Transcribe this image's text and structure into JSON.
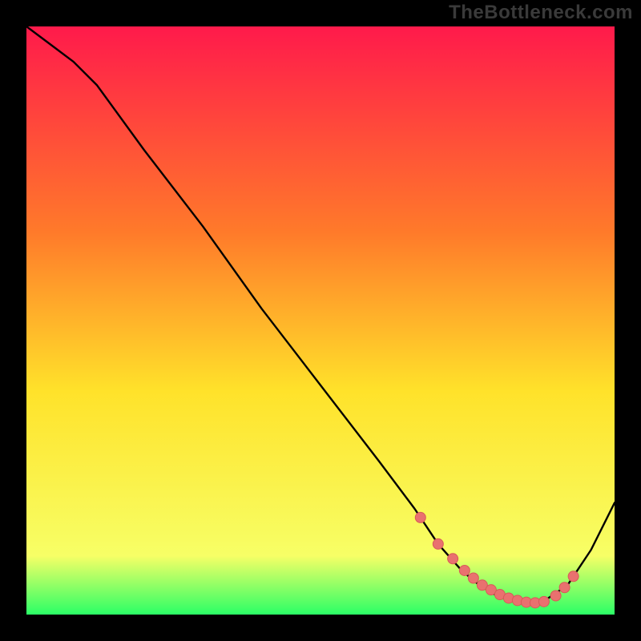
{
  "watermark": "TheBottleneck.com",
  "colors": {
    "frame": "#000000",
    "grad_top": "#ff1a4b",
    "grad_mid1": "#ff7a2a",
    "grad_mid2": "#ffe22a",
    "grad_low": "#f7ff66",
    "grad_bottom": "#2bff66",
    "curve": "#000000",
    "marker_fill": "#e9716f",
    "marker_stroke": "#d85a58"
  },
  "chart_data": {
    "type": "line",
    "title": "",
    "xlabel": "",
    "ylabel": "",
    "xlim": [
      0,
      100
    ],
    "ylim": [
      0,
      100
    ],
    "grid": false,
    "series": [
      {
        "name": "bottleneck-curve",
        "x": [
          0,
          4,
          8,
          12,
          20,
          30,
          40,
          50,
          60,
          66,
          70,
          74,
          77,
          80,
          83,
          86,
          88,
          92,
          96,
          100
        ],
        "y": [
          100,
          97,
          94,
          90,
          79,
          66,
          52,
          39,
          26,
          18,
          12,
          7.5,
          5,
          3.2,
          2.3,
          2.0,
          2.3,
          5,
          11,
          19
        ]
      }
    ],
    "markers": {
      "name": "highlight-dots",
      "x": [
        67,
        70,
        72.5,
        74.5,
        76,
        77.5,
        79,
        80.5,
        82,
        83.5,
        85,
        86.5,
        88,
        90,
        91.5,
        93
      ],
      "y": [
        16.5,
        12,
        9.5,
        7.5,
        6.2,
        5,
        4.2,
        3.4,
        2.8,
        2.4,
        2.1,
        2.0,
        2.2,
        3.2,
        4.6,
        6.5
      ]
    }
  }
}
